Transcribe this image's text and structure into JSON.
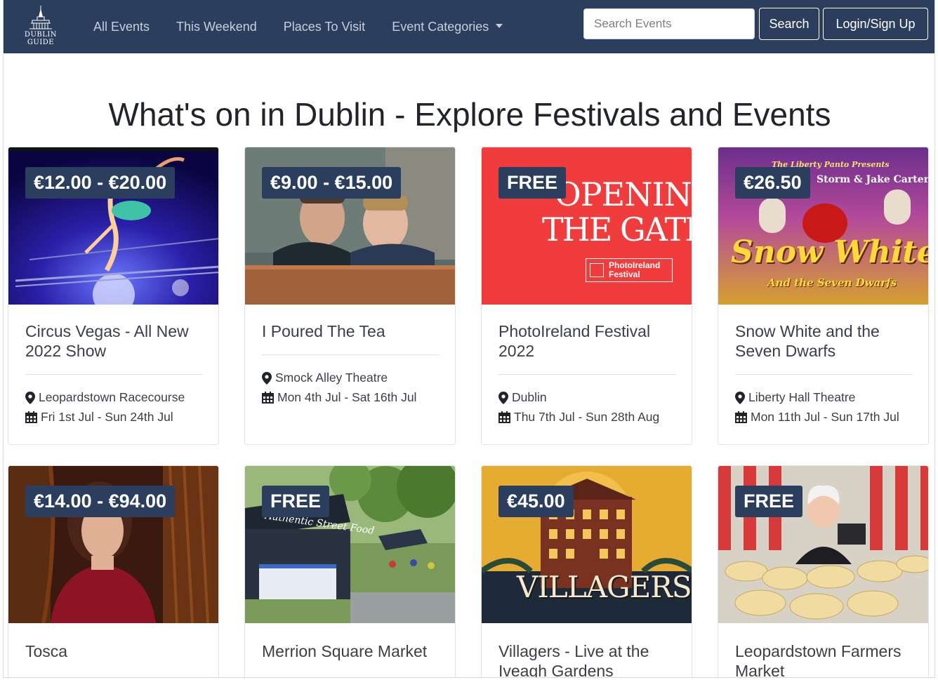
{
  "brand": {
    "logo_text": "DUBLIN GUIDE"
  },
  "nav": {
    "links": [
      "All Events",
      "This Weekend",
      "Places To Visit",
      "Event Categories"
    ],
    "search_placeholder": "Search Events",
    "search_button": "Search",
    "login_button": "Login/Sign Up"
  },
  "page_title": "What's on in Dublin - Explore Festivals and Events",
  "events": [
    {
      "price": "€12.00 - €20.00",
      "title": "Circus Vegas - All New 2022 Show",
      "venue": "Leopardstown Racecourse",
      "dates": "Fri 1st Jul - Sun 24th Jul",
      "image_icon": "circus-aerialist-image"
    },
    {
      "price": "€9.00 - €15.00",
      "title": "I Poured The Tea",
      "venue": "Smock Alley Theatre",
      "dates": "Mon 4th Jul - Sat 16th Jul",
      "image_icon": "two-men-peeking-image"
    },
    {
      "price": "FREE",
      "title": "PhotoIreland Festival 2022",
      "venue": "Dublin",
      "dates": "Thu 7th Jul - Sun 28th Aug",
      "image_icon": "opening-the-gate-poster-image",
      "poster_text": [
        "OPENING",
        "THE GATE",
        "PhotoIreland",
        "Festival"
      ]
    },
    {
      "price": "€26.50",
      "title": "Snow White and the Seven Dwarfs",
      "venue": "Liberty Hall Theatre",
      "dates": "Mon 11th Jul - Sun 17th Jul",
      "image_icon": "snow-white-panto-poster-image",
      "poster_text": [
        "The Liberty Panto Presents",
        "Storm & Jake Carter in",
        "Snow White",
        "And the Seven Dwarfs"
      ]
    },
    {
      "price": "€14.00 - €94.00",
      "title": "Tosca",
      "image_icon": "tosca-portrait-image"
    },
    {
      "price": "FREE",
      "title": "Merrion Square Market",
      "image_icon": "street-food-market-image",
      "poster_text": [
        "Authentic Street Food"
      ]
    },
    {
      "price": "€45.00",
      "title": "Villagers - Live at the Iveagh Gardens",
      "image_icon": "villagers-poster-image",
      "poster_text": [
        "VILLAGERS"
      ]
    },
    {
      "price": "FREE",
      "title": "Leopardstown Farmers Market",
      "image_icon": "cheese-stall-image"
    }
  ],
  "colors": {
    "navbar": "#2c3e5e",
    "badge": "#2c3e5e"
  }
}
